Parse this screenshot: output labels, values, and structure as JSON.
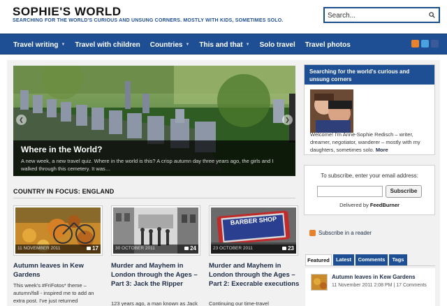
{
  "header": {
    "site_title": "SOPHIE'S WORLD",
    "tagline": "SEARCHING FOR THE WORLD'S CURIOUS AND UNSUNG CORNERS. MOSTLY WITH KIDS, SOMETIMES SOLO.",
    "search_placeholder": "Search..."
  },
  "nav": {
    "items": [
      {
        "label": "Travel writing",
        "caret": "▼"
      },
      {
        "label": "Travel with children",
        "caret": ""
      },
      {
        "label": "Countries",
        "caret": "▼"
      },
      {
        "label": "This and that",
        "caret": "▼"
      },
      {
        "label": "Solo travel",
        "caret": ""
      },
      {
        "label": "Travel photos",
        "caret": ""
      }
    ],
    "social": [
      "rss",
      "twitter",
      "facebook"
    ]
  },
  "slider": {
    "title": "Where in the World?",
    "text": "A new week, a new travel quiz. Where in the world is this? A crisp autumn day three years ago, the girls and I walked through this cemetery. It was…",
    "prev": "❮",
    "next": "❯"
  },
  "focus": {
    "heading": "COUNTRY IN FOCUS: ENGLAND",
    "posts": [
      {
        "date": "11 NOVEMBER 2011",
        "comments": "17",
        "title": "Autumn leaves in Kew Gardens",
        "excerpt": "This week's #FriFotos* theme – autumn/fall - inspired me to add an extra post. I've just returned"
      },
      {
        "date": "30 OCTOBER 2011",
        "comments": "24",
        "title": "Murder and Mayhem in London through the Ages – Part 3: Jack the Ripper",
        "excerpt": "123 years ago, a man known as Jack hung around Whitechapel,"
      },
      {
        "date": "23 OCTOBER 2011",
        "comments": "23",
        "title": "Murder and Mayhem in London through the Ages – Part 2: Execrable executions",
        "excerpt": "Continuing our time-travel"
      }
    ],
    "barber_sign": "BARBER SHOP"
  },
  "sidebar": {
    "about_heading": "Searching for the world's curious and unsung corners",
    "about_text": "Welcome! I'm Anne-Sophie Redisch – writer, dreamer, negotiator, wanderer – mostly with my daughters, sometimes solo.",
    "about_more": "More",
    "subscribe_label": "To subscribe, enter your email address:",
    "subscribe_button": "Subscribe",
    "delivered_by": "Delivered by",
    "feedburner": "FeedBurner",
    "reader_link": "Subscribe in a reader",
    "tabs": [
      "Featured",
      "Latest",
      "Comments",
      "Tags"
    ],
    "featured": {
      "title": "Autumn leaves in Kew Gardens",
      "meta": "11 November 2011 2:08 PM | 17 Comments"
    }
  },
  "colors": {
    "brand_blue": "#1e4f94",
    "page_bg": "#f1f1f1"
  }
}
